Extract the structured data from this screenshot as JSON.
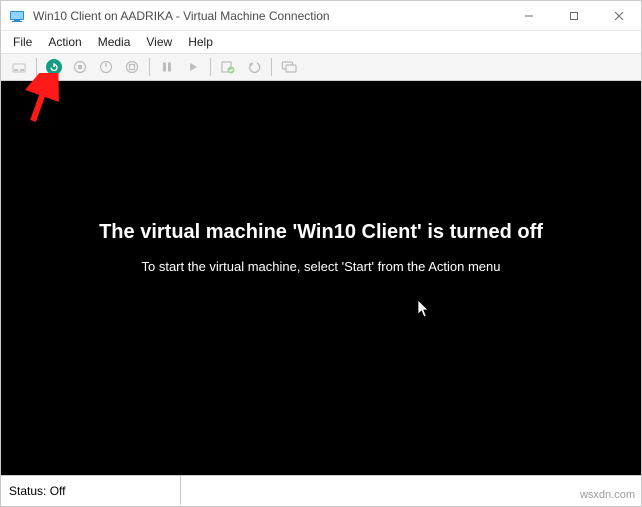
{
  "window": {
    "title": "Win10 Client on AADRIKA - Virtual Machine Connection"
  },
  "menu": {
    "file": "File",
    "action": "Action",
    "media": "Media",
    "view": "View",
    "help": "Help"
  },
  "viewport": {
    "main_message": "The virtual machine 'Win10 Client' is turned off",
    "sub_message": "To start the virtual machine, select 'Start' from the Action menu"
  },
  "status": {
    "label": "Status: Off"
  },
  "watermark": "wsxdn.com"
}
